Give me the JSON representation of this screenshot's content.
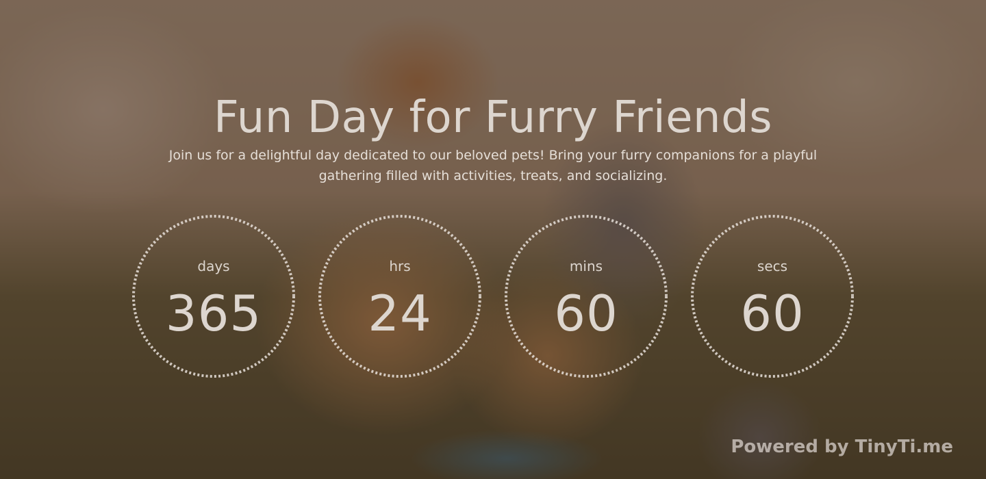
{
  "hero": {
    "title": "Fun Day for Furry Friends",
    "description": "Join us for a delightful day dedicated to our beloved pets! Bring your furry companions for a playful gathering filled with activities, treats, and socializing."
  },
  "countdown": [
    {
      "label": "days",
      "value": "365"
    },
    {
      "label": "hrs",
      "value": "24"
    },
    {
      "label": "mins",
      "value": "60"
    },
    {
      "label": "secs",
      "value": "60"
    }
  ],
  "footer": {
    "powered_by": "Powered by TinyTi.me"
  },
  "colors": {
    "overlay": "#3a281e",
    "text": "#ddd6cf",
    "ring": "#e8e1da"
  }
}
